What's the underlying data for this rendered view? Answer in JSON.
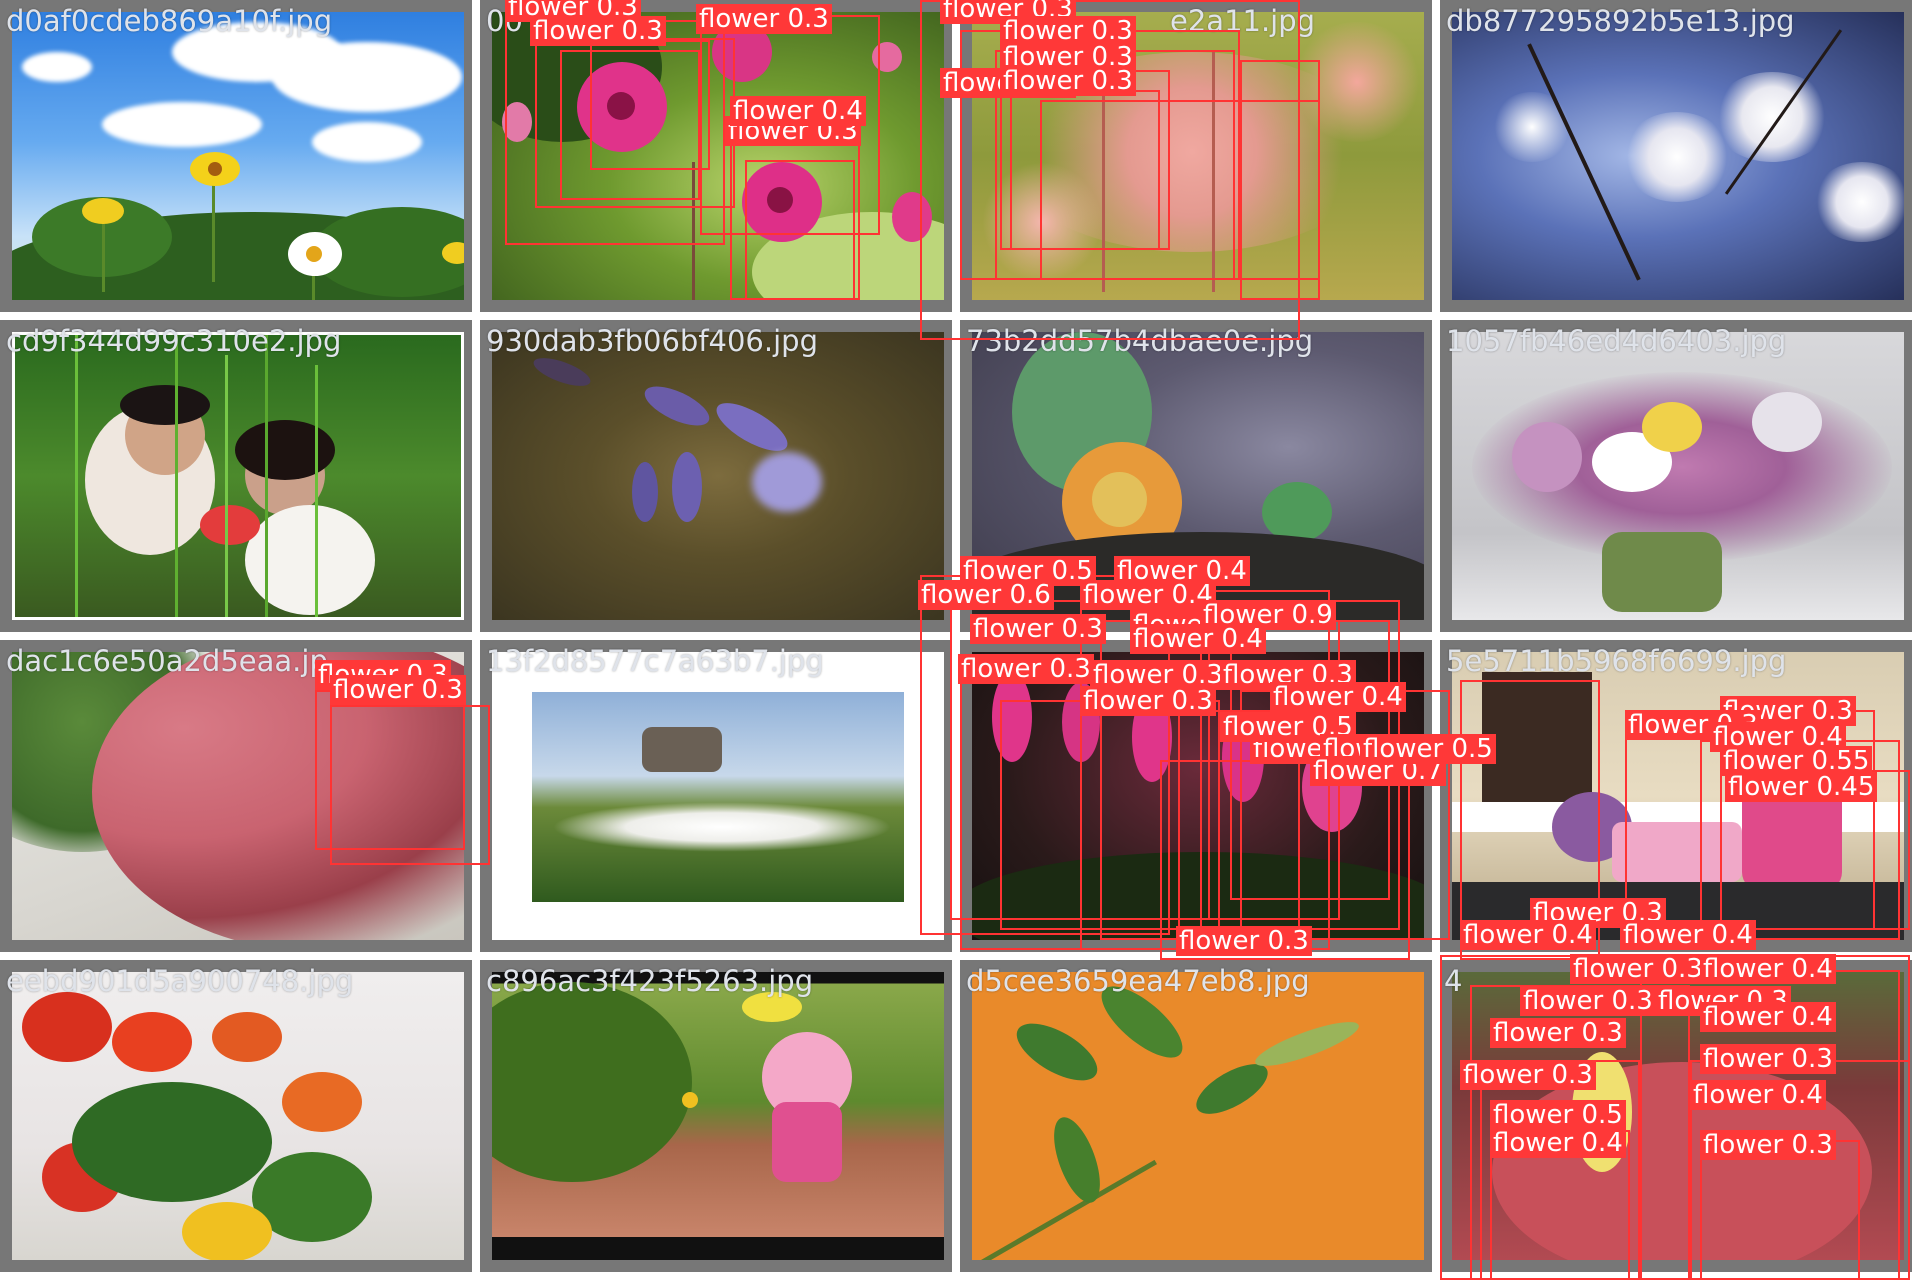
{
  "mosaic": {
    "tiles": [
      {
        "filename": "d0af0cdeb869a10f.jpg"
      },
      {
        "filename": "00"
      },
      {
        "filename": "e2a11.jpg"
      },
      {
        "filename": "db877295892b5e13.jpg"
      },
      {
        "filename": "cd9f344d99c310e2.jpg"
      },
      {
        "filename": "930dab3fb06bf406.jpg"
      },
      {
        "filename": "73b2dd57b4dbae0e.jpg"
      },
      {
        "filename": "1057fb46ed4d6403.jpg"
      },
      {
        "filename": "dac1c6e50a2d5eaa.jp"
      },
      {
        "filename": "13f2d8577c7a63b7.jpg"
      },
      {
        "filename": ""
      },
      {
        "filename": "5e5711b5968f6699.jpg"
      },
      {
        "filename": "eebd901d5a900748.jpg"
      },
      {
        "filename": "c896ac3f423f5263.jpg"
      },
      {
        "filename": "d5cee3659ea47eb8.jpg"
      },
      {
        "filename": "4"
      }
    ]
  },
  "detection_labels": [
    "flower 0.3",
    "flower 0.3",
    "flower 0.3",
    "flower 0.3",
    "flower 0.4",
    "flower 0.3",
    "flower 0.3",
    "flower 0.3",
    "flower 0.3",
    "flower 0.3",
    "flower 0.3",
    "flower 0.3",
    "flower 0.5",
    "flower 0.4",
    "flower 0.6",
    "flower 0.4",
    "flower 0.7",
    "flower 0.9",
    "flower 0.3",
    "flower 0.4",
    "flower 0.3",
    "flower 0.3",
    "flower 0.3",
    "flower 0.4",
    "flower 0.3",
    "flower 0.4",
    "flower 0.5",
    "flower 0.4",
    "flower 0.7",
    "flower 0.5",
    "flower 0.3",
    "flower 0.3",
    "flower 0.3",
    "flower 0.4",
    "flower 0.55",
    "flower 0.45",
    "flower 0.3",
    "flower 0.4",
    "flower 0.4",
    "flower 0.3",
    "flower 0.4",
    "flower 0.3",
    "flower 0.3",
    "flower 0.4",
    "flower 0.3",
    "flower 0.3",
    "flower 0.3",
    "flower 0.5",
    "flower 0.4",
    "flower 0.4",
    "flower 0.3"
  ],
  "colors": {
    "tile_border": "#777777",
    "box_stroke": "#ff3333",
    "label_bg": "#ff3838",
    "label_text": "#ffffff",
    "filename_text": "#dfe3ea"
  }
}
